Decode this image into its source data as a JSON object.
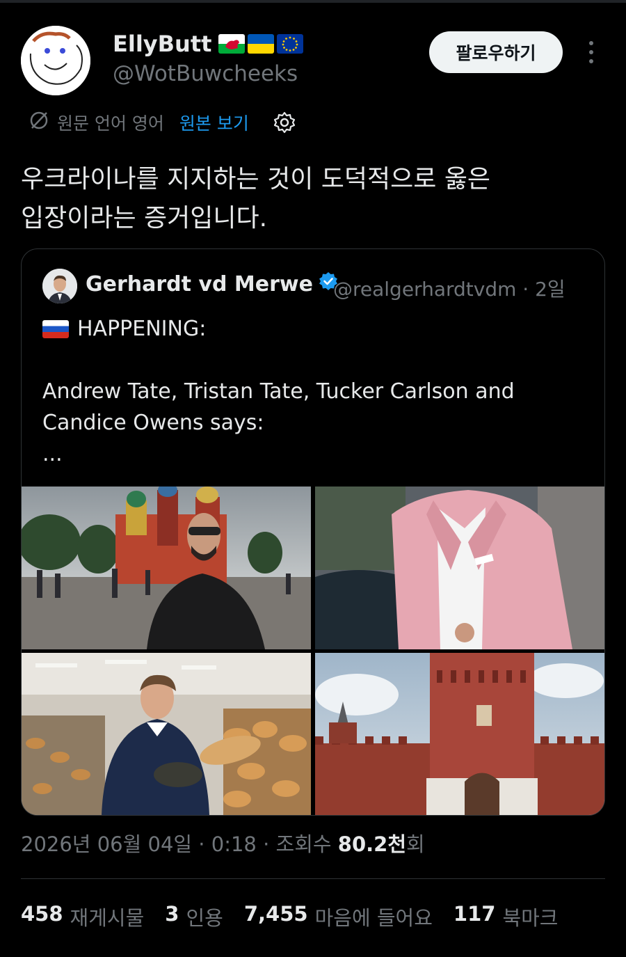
{
  "author": {
    "display_name": "EllyButt",
    "handle": "@WotBuwcheeks",
    "flags": [
      "wales-flag-icon",
      "ukraine-flag-icon",
      "eu-flag-icon"
    ]
  },
  "follow_label": "팔로우하기",
  "translation": {
    "lang_label": "원문 언어 영어",
    "show_original": "원본 보기"
  },
  "tweet_text": [
    "우크라이나를 지지하는 것이 도덕적으로 옳은",
    "입장이라는 증거입니다."
  ],
  "quote": {
    "name": "Gerhardt vd Merwe",
    "handle": "@realgerhardtvdm",
    "time": "· 2일",
    "happening": "HAPPENING:",
    "body_lines": [
      "Andrew Tate, Tristan Tate, Tucker Carlson and",
      "Candice Owens says:"
    ],
    "ellipsis": "..."
  },
  "timestamp": {
    "datetime": "2026년 06월 04일 · 0:18 · 조회수 ",
    "views": "80.2천",
    "suffix": "회"
  },
  "stats": [
    {
      "num": "458",
      "label": "재게시물"
    },
    {
      "num": "3",
      "label": "인용"
    },
    {
      "num": "7,455",
      "label": "마음에 들어요"
    },
    {
      "num": "117",
      "label": "북마크"
    }
  ],
  "colors": {
    "background": "#000000",
    "text": "#e7e9ea",
    "secondary": "#71767b",
    "link": "#1d9bf0",
    "border": "#2f3336"
  }
}
